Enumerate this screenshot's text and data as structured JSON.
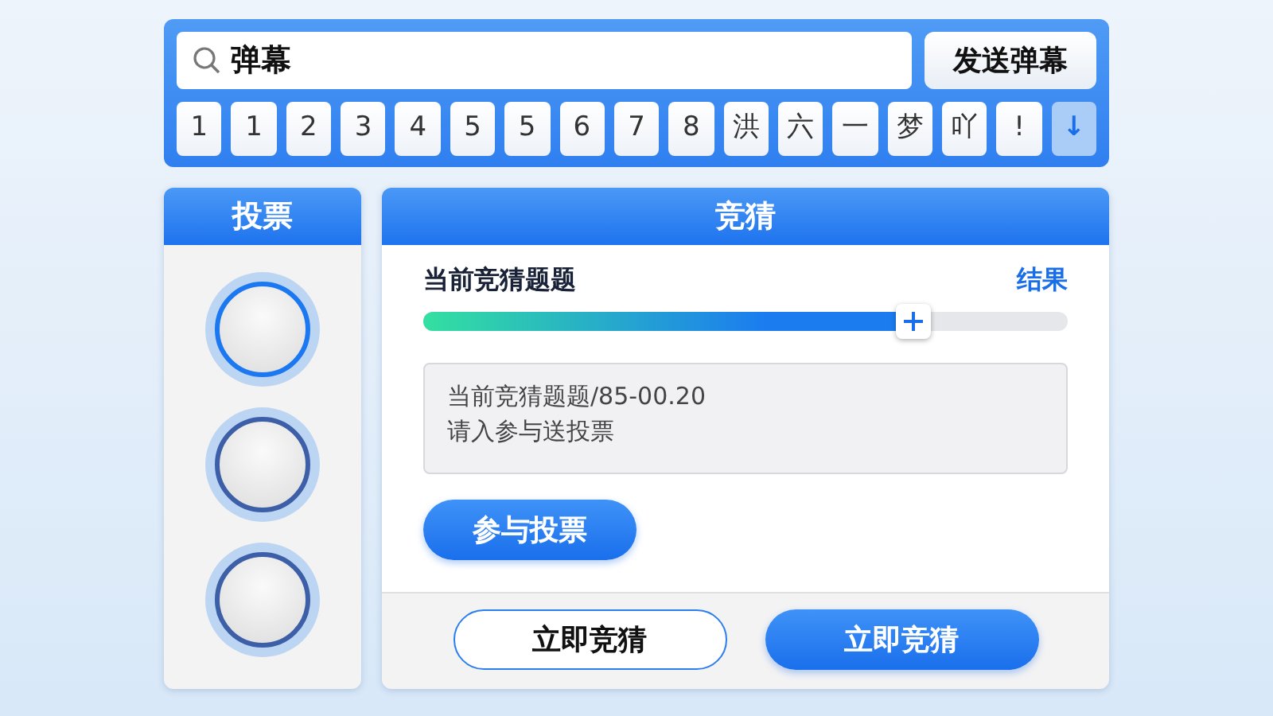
{
  "search": {
    "value": "弹幕"
  },
  "send_button": "发送弹幕",
  "keys": [
    {
      "label": "1",
      "kind": "char"
    },
    {
      "label": "1",
      "kind": "char"
    },
    {
      "label": "2",
      "kind": "char"
    },
    {
      "label": "3",
      "kind": "char"
    },
    {
      "label": "4",
      "kind": "char"
    },
    {
      "label": "5",
      "kind": "char"
    },
    {
      "label": "5",
      "kind": "char"
    },
    {
      "label": "6",
      "kind": "char"
    },
    {
      "label": "7",
      "kind": "char"
    },
    {
      "label": "8",
      "kind": "char"
    },
    {
      "label": "洪",
      "kind": "char"
    },
    {
      "label": "六",
      "kind": "char"
    },
    {
      "label": "一",
      "kind": "char"
    },
    {
      "label": "梦",
      "kind": "char"
    },
    {
      "label": "吖",
      "kind": "char"
    },
    {
      "label": "!",
      "kind": "char"
    },
    {
      "label": "↓",
      "kind": "action"
    }
  ],
  "vote_panel": {
    "title": "投票",
    "options": [
      {
        "selected": true
      },
      {
        "selected": false
      },
      {
        "selected": false
      }
    ]
  },
  "guess_panel": {
    "title": "竞猜",
    "question": "当前竞猜题题",
    "result_link": "结果",
    "slider": {
      "level": 0.76
    },
    "info_lines": [
      "当前竞猜题题/85-00.20",
      "请入参与送投票"
    ],
    "join_button": "参与投票",
    "actions": [
      {
        "label": "立即竞猜",
        "kind": "outline"
      },
      {
        "label": "立即竞猜",
        "kind": "primary"
      }
    ]
  }
}
